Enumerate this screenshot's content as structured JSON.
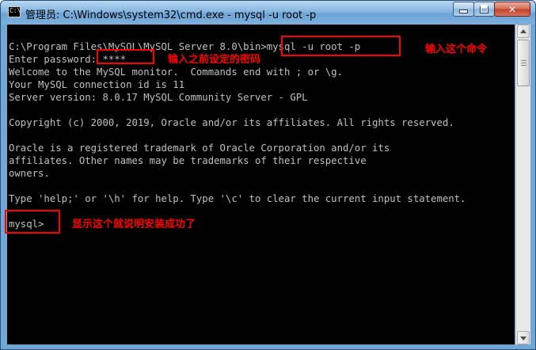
{
  "window": {
    "icon_text": "C:\\",
    "title": "管理员: C:\\Windows\\system32\\cmd.exe - mysql  -u root -p",
    "buttons": {
      "minimize": "minimize",
      "maximize": "maximize",
      "close": "✕"
    }
  },
  "console": {
    "lines": [
      "C:\\Program Files\\MySQL\\MySQL Server 8.0\\bin>mysql -u root -p",
      "Enter password: ****",
      "Welcome to the MySQL monitor.  Commands end with ; or \\g.",
      "Your MySQL connection id is 11",
      "Server version: 8.0.17 MySQL Community Server - GPL",
      "",
      "Copyright (c) 2000, 2019, Oracle and/or its affiliates. All rights reserved.",
      "",
      "Oracle is a registered trademark of Oracle Corporation and/or its",
      "affiliates. Other names may be trademarks of their respective",
      "owners.",
      "",
      "Type 'help;' or '\\h' for help. Type '\\c' to clear the current input statement.",
      "",
      "mysql>"
    ]
  },
  "annotations": {
    "command": "输入这个命令",
    "password": "输入之前设定的密码",
    "prompt": "显示这个就说明安装成功了",
    "color": "#ff0000"
  }
}
